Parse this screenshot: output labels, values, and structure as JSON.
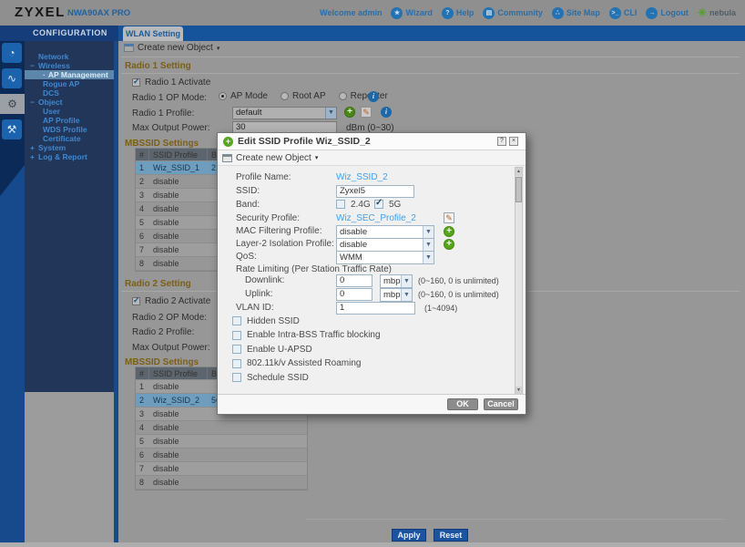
{
  "colors": {
    "accent_blue": "#1c64a8",
    "link_blue": "#41a0eb",
    "green_add": "#58a71c",
    "heading_brown": "#7a5f14",
    "selected_row_blue": "#6f9dbd",
    "sidebar_navy": "#22365a"
  },
  "header": {
    "logo": "ZYXEL",
    "model": "NWA90AX PRO",
    "welcome": "Welcome admin",
    "links": [
      {
        "label": "Wizard",
        "icon": "wizard-icon",
        "glyph": "★"
      },
      {
        "label": "Help",
        "icon": "help-icon",
        "glyph": "?"
      },
      {
        "label": "Community",
        "icon": "community-icon",
        "glyph": "▤"
      },
      {
        "label": "Site Map",
        "icon": "site-map-icon",
        "glyph": "∴"
      },
      {
        "label": "CLI",
        "icon": "cli-icon",
        "glyph": ">_"
      },
      {
        "label": "Logout",
        "icon": "logout-icon",
        "glyph": "→"
      }
    ],
    "nebula_label": "nebula",
    "nebula_glyph": "✳"
  },
  "sidebar": {
    "title": "CONFIGURATION",
    "rail": [
      {
        "icon": "dashboard-icon",
        "glyph": "◔",
        "active": false
      },
      {
        "icon": "monitor-icon",
        "glyph": "∿",
        "active": false
      },
      {
        "icon": "configuration-icon",
        "glyph": "⚙",
        "active": true
      },
      {
        "icon": "maintenance-icon",
        "glyph": "⚒",
        "active": false
      }
    ],
    "items": [
      {
        "label": "Network",
        "level": 0,
        "expand": ""
      },
      {
        "label": "Wireless",
        "level": 0,
        "expand": "−"
      },
      {
        "label": "AP Management",
        "level": 1,
        "bullet": true,
        "active": true
      },
      {
        "label": "Rogue AP",
        "level": 1
      },
      {
        "label": "DCS",
        "level": 1
      },
      {
        "label": "Object",
        "level": 0,
        "expand": "−"
      },
      {
        "label": "User",
        "level": 1
      },
      {
        "label": "AP Profile",
        "level": 1
      },
      {
        "label": "WDS Profile",
        "level": 1
      },
      {
        "label": "Certificate",
        "level": 1
      },
      {
        "label": "System",
        "level": 0,
        "expand": "+"
      },
      {
        "label": "Log & Report",
        "level": 0,
        "expand": "+"
      }
    ]
  },
  "main": {
    "tab": "WLAN Setting",
    "create_new_object": "Create new Object",
    "radio1": {
      "heading": "Radio 1 Setting",
      "activate_label": "Radio 1 Activate",
      "activate_checked": true,
      "op_mode_label": "Radio 1 OP Mode:",
      "op_modes": [
        {
          "label": "AP Mode",
          "selected": true
        },
        {
          "label": "Root AP",
          "selected": false
        },
        {
          "label": "Repeater",
          "selected": false
        }
      ],
      "profile_label": "Radio 1 Profile:",
      "profile_value": "default",
      "power_label": "Max Output Power:",
      "power_value": "30",
      "power_hint": "dBm (0~30)"
    },
    "mbssid1": {
      "heading": "MBSSID Settings",
      "columns": [
        "#",
        "SSID Profile",
        "Band"
      ],
      "rows": [
        {
          "n": "1",
          "profile": "Wiz_SSID_1",
          "band": "2.4G",
          "selected": true
        },
        {
          "n": "2",
          "profile": "disable",
          "band": ""
        },
        {
          "n": "3",
          "profile": "disable",
          "band": ""
        },
        {
          "n": "4",
          "profile": "disable",
          "band": ""
        },
        {
          "n": "5",
          "profile": "disable",
          "band": ""
        },
        {
          "n": "6",
          "profile": "disable",
          "band": ""
        },
        {
          "n": "7",
          "profile": "disable",
          "band": ""
        },
        {
          "n": "8",
          "profile": "disable",
          "band": ""
        }
      ]
    },
    "radio2": {
      "heading": "Radio 2 Setting",
      "activate_label": "Radio 2 Activate",
      "activate_checked": true,
      "op_mode_label": "Radio 2 OP Mode:",
      "profile_label": "Radio 2 Profile:",
      "power_label": "Max Output Power:"
    },
    "mbssid2": {
      "heading": "MBSSID Settings",
      "columns": [
        "#",
        "SSID Profile",
        "Band"
      ],
      "rows": [
        {
          "n": "1",
          "profile": "disable",
          "band": ""
        },
        {
          "n": "2",
          "profile": "Wiz_SSID_2",
          "band": "5G",
          "selected": true
        },
        {
          "n": "3",
          "profile": "disable",
          "band": ""
        },
        {
          "n": "4",
          "profile": "disable",
          "band": ""
        },
        {
          "n": "5",
          "profile": "disable",
          "band": ""
        },
        {
          "n": "6",
          "profile": "disable",
          "band": ""
        },
        {
          "n": "7",
          "profile": "disable",
          "band": ""
        },
        {
          "n": "8",
          "profile": "disable",
          "band": ""
        }
      ]
    },
    "apply": "Apply",
    "reset": "Reset"
  },
  "dialog": {
    "title": "Edit SSID Profile Wiz_SSID_2",
    "help_glyph": "?",
    "close_glyph": "×",
    "create_new_object": "Create new Object",
    "profile_name_label": "Profile Name:",
    "profile_name_value": "Wiz_SSID_2",
    "ssid_label": "SSID:",
    "ssid_value": "Zyxel5",
    "band_label": "Band:",
    "band_24_label": "2.4G",
    "band_24_checked": false,
    "band_5_label": "5G",
    "band_5_checked": true,
    "security_label": "Security Profile:",
    "security_value": "Wiz_SEC_Profile_2",
    "mac_label": "MAC Filtering Profile:",
    "mac_value": "disable",
    "l2_label": "Layer-2 Isolation Profile:",
    "l2_value": "disable",
    "qos_label": "QoS:",
    "qos_value": "WMM",
    "rate_label": "Rate Limiting (Per Station Traffic Rate)",
    "downlink_label": "Downlink:",
    "downlink_value": "0",
    "downlink_unit": "mbps",
    "downlink_hint": "(0~160, 0 is unlimited)",
    "uplink_label": "Uplink:",
    "uplink_value": "0",
    "uplink_unit": "mbps",
    "uplink_hint": "(0~160, 0 is unlimited)",
    "vlan_label": "VLAN ID:",
    "vlan_value": "1",
    "vlan_hint": "(1~4094)",
    "checkboxes": [
      {
        "label": "Hidden SSID",
        "checked": false
      },
      {
        "label": "Enable Intra-BSS Traffic blocking",
        "checked": false
      },
      {
        "label": "Enable U-APSD",
        "checked": false
      },
      {
        "label": "802.11k/v Assisted Roaming",
        "checked": false
      },
      {
        "label": "Schedule SSID",
        "checked": false
      }
    ],
    "ok": "OK",
    "cancel": "Cancel"
  }
}
